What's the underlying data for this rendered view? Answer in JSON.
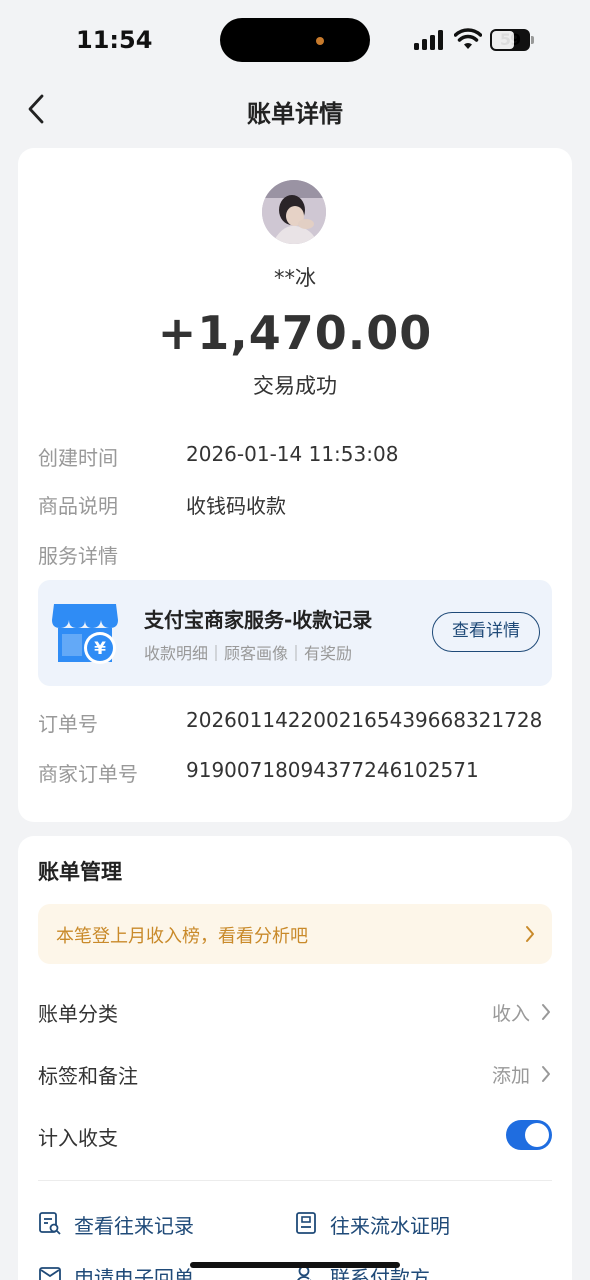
{
  "status_bar": {
    "time": "11:54",
    "battery": "59"
  },
  "nav": {
    "title": "账单详情"
  },
  "payer": {
    "name": "**冰",
    "amount": "+1,470.00",
    "status": "交易成功"
  },
  "details": {
    "created_label": "创建时间",
    "created_value": "2026-01-14 11:53:08",
    "desc_label": "商品说明",
    "desc_value": "收钱码收款",
    "service_label": "服务详情",
    "order_label": "订单号",
    "order_value": "2026011422002165439668321728",
    "merchant_order_label": "商家订单号",
    "merchant_order_value": "919007180943772461025​71"
  },
  "service": {
    "title": "支付宝商家服务-收款记录",
    "subtitle": "收款明细｜顾客画像｜有奖励",
    "button": "查看详情"
  },
  "manage": {
    "title": "账单管理",
    "tip": "本笔登上月收入榜，看看分析吧",
    "category_label": "账单分类",
    "category_value": "收入",
    "tags_label": "标签和备注",
    "tags_value": "添加",
    "count_label": "计入收支",
    "count_enabled": true
  },
  "links": [
    {
      "label": "查看往来记录",
      "icon": "record-search-icon"
    },
    {
      "label": "往来流水证明",
      "icon": "certificate-icon"
    },
    {
      "label": "申请电子回单",
      "icon": "mail-icon"
    },
    {
      "label": "联系付款方",
      "icon": "contact-icon"
    }
  ],
  "colors": {
    "accent": "#1f4a78",
    "toggle": "#1f6de0",
    "tip_text": "#c98a2a",
    "tip_bg": "#fdf6e9",
    "shop_icon": "#2f8cf5"
  }
}
